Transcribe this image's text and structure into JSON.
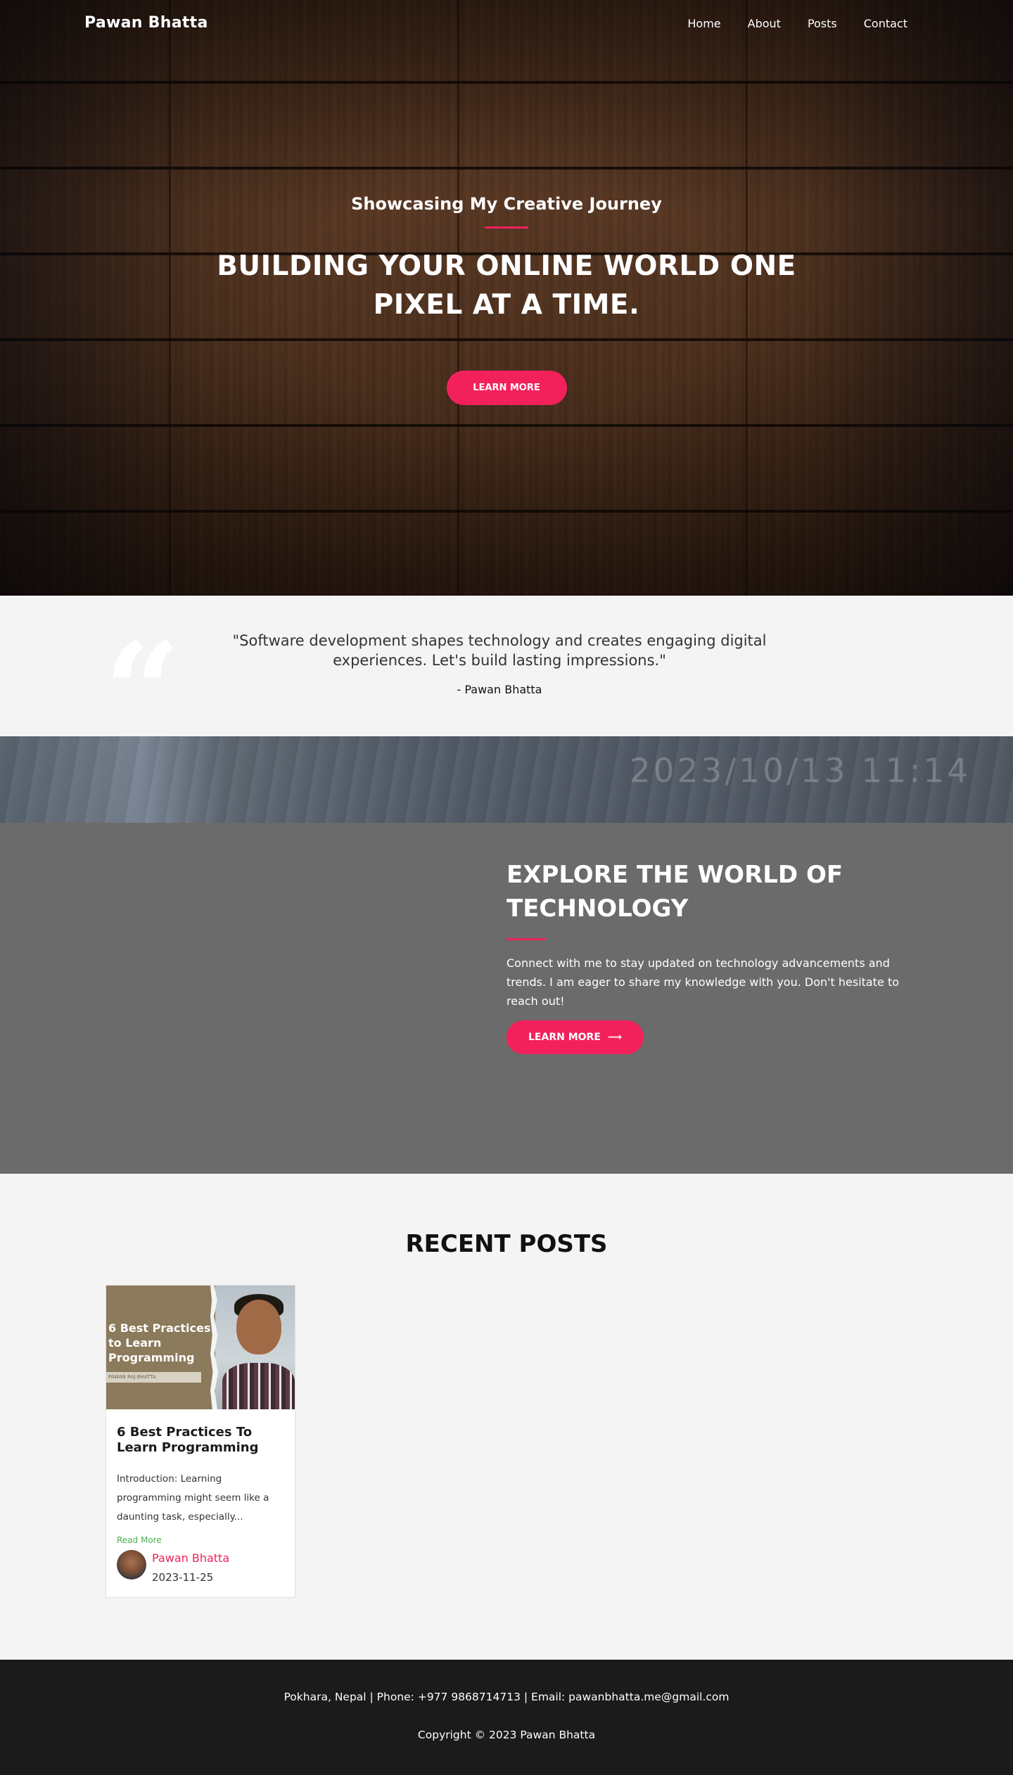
{
  "nav": {
    "brand": "Pawan Bhatta",
    "links": [
      "Home",
      "About",
      "Posts",
      "Contact"
    ]
  },
  "hero": {
    "subtitle": "Showcasing My Creative Journey",
    "title": "BUILDING YOUR ONLINE WORLD ONE PIXEL AT A TIME.",
    "button": "LEARN MORE"
  },
  "quote": {
    "mark": "“",
    "text": "\"Software development shapes technology and creates engaging digital experiences. Let's build lasting impressions.\"",
    "author": "- Pawan Bhatta"
  },
  "date_banner": {
    "datetime": "2023/10/13 11:14"
  },
  "explore": {
    "title": "EXPLORE THE WORLD OF TECHNOLOGY",
    "text": "Connect with me to stay updated on technology advancements and trends. I am eager to share my knowledge with you. Don't hesitate to reach out!",
    "button": "LEARN MORE",
    "button_icon": "arrow-right-icon"
  },
  "posts": {
    "heading": "RECENT POSTS",
    "items": [
      {
        "image_text": "6 Best Practices to Learn Programming",
        "image_byline": "PAWAN RAJ BHATTA",
        "title": "6 Best Practices To Learn Programming",
        "excerpt": "Introduction: Learning programming might seem like a daunting task, especially...",
        "read_more": "Read More",
        "author": "Pawan Bhatta",
        "date": "2023-11-25"
      }
    ]
  },
  "footer": {
    "contact": "Pokhara, Nepal | Phone: +977 9868714713 | Email: pawanbhatta.me@gmail.com",
    "copyright": "Copyright © 2023 Pawan Bhatta"
  },
  "colors": {
    "accent": "#f3215b",
    "read_more": "#4caf50",
    "footer_bg": "#1b1b1b",
    "explore_bg": "#6b6b6b"
  }
}
